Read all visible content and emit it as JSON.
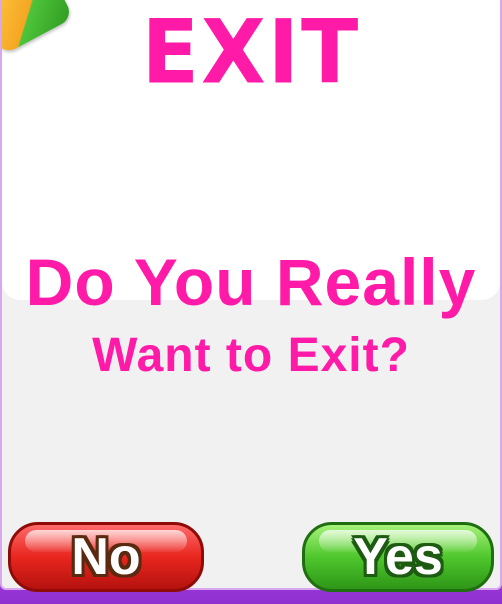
{
  "dialog": {
    "title": "EXIT",
    "question_line1": "Do You Really",
    "question_line2": "Want to Exit?"
  },
  "buttons": {
    "no_label": "No",
    "yes_label": "Yes"
  },
  "colors": {
    "title": "#ff1aa8",
    "no_button": "#e8261f",
    "yes_button": "#4fc72d",
    "background": "#b64ce8"
  }
}
